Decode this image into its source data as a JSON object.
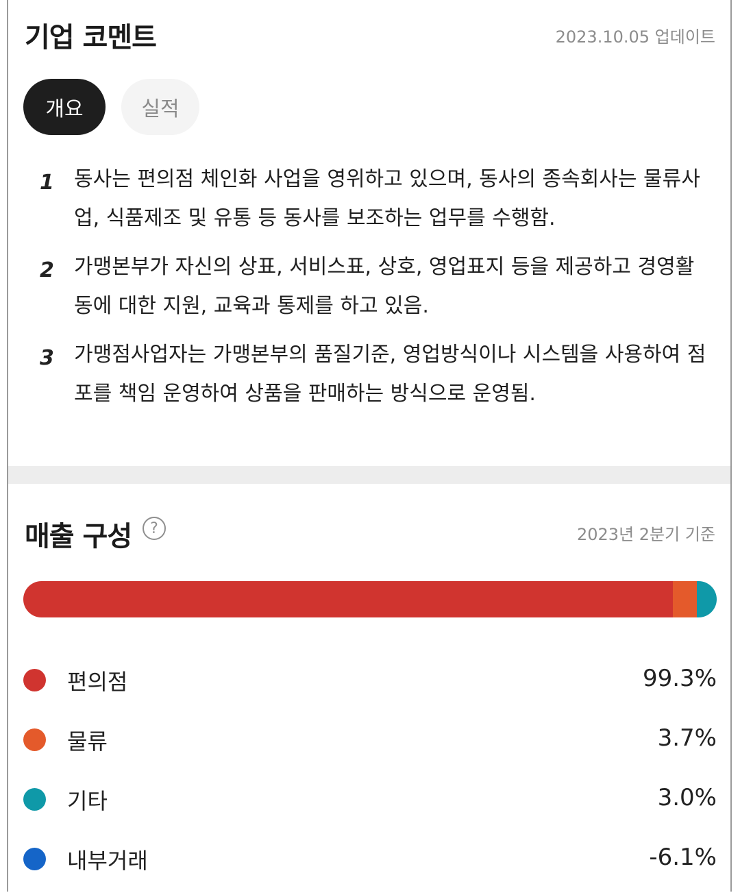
{
  "company_comment": {
    "title": "기업 코멘트",
    "updated": "2023.10.05 업데이트",
    "tabs": [
      {
        "label": "개요",
        "active": true
      },
      {
        "label": "실적",
        "active": false
      }
    ],
    "items": [
      {
        "num": "1",
        "text": "동사는 편의점 체인화 사업을 영위하고 있으며, 동사의 종속회사는 물류사업, 식품제조 및 유통 등 동사를 보조하는 업무를 수행함."
      },
      {
        "num": "2",
        "text": "가맹본부가 자신의 상표, 서비스표, 상호, 영업표지 등을 제공하고 경영활동에 대한 지원, 교육과 통제를 하고 있음."
      },
      {
        "num": "3",
        "text": "가맹점사업자는 가맹본부의 품질기준, 영업방식이나 시스템을 사용하여 점포를 책임 운영하여 상품을 판매하는 방식으로 운영됨."
      }
    ]
  },
  "sales": {
    "title": "매출 구성",
    "help_icon": "question-circle-icon",
    "basis": "2023년 2분기 기준",
    "help_glyph": "?"
  },
  "chart_data": {
    "type": "bar",
    "categories": [
      "편의점",
      "물류",
      "기타",
      "내부거래"
    ],
    "values": [
      99.3,
      3.7,
      3.0,
      -6.1
    ],
    "value_labels": [
      "99.3%",
      "3.7%",
      "3.0%",
      "-6.1%"
    ],
    "colors": [
      "#d0342f",
      "#e45a2b",
      "#0f99a8",
      "#1565c8"
    ],
    "stacked": true,
    "legend": "bottom"
  }
}
